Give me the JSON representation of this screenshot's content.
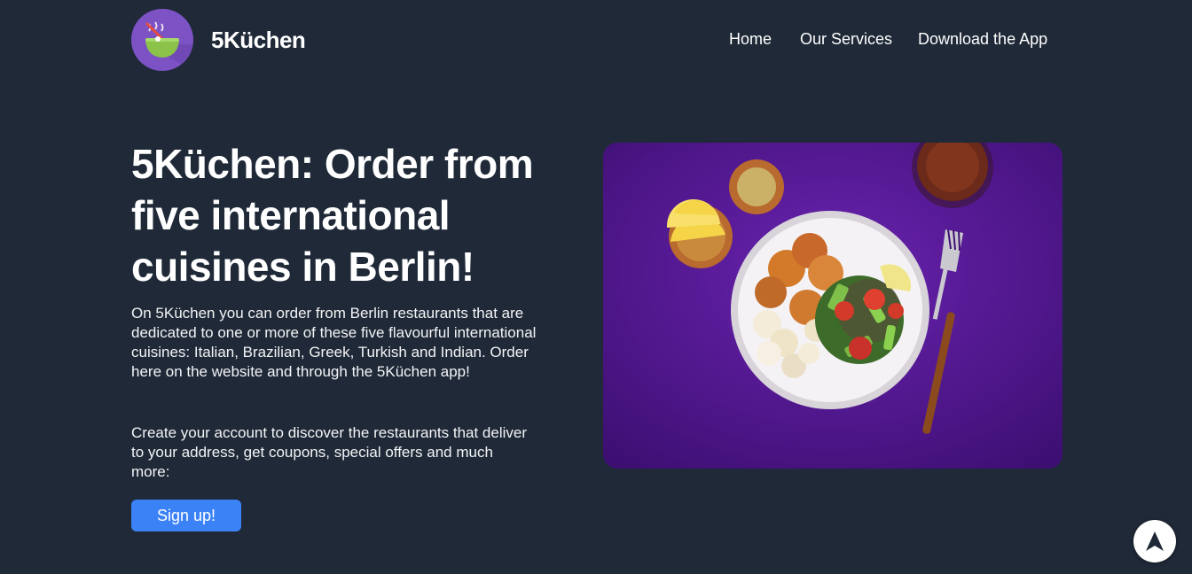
{
  "header": {
    "brand": "5Küchen",
    "logo_icon": "bowl-icon",
    "nav": [
      {
        "label": "Home"
      },
      {
        "label": "Our Services"
      },
      {
        "label": "Download the App"
      }
    ]
  },
  "hero": {
    "title": "5Küchen: Order from five international cuisines in Berlin!",
    "paragraph_1": "On 5Küchen you can order from Berlin restaurants that are dedicated to one or more of these five flavourful international cuisines: Italian, Brazilian, Greek, Turkish and Indian. Order here on the website and through the 5Küchen app!",
    "paragraph_2": "Create your account to discover the restaurants that deliver to your address, get coupons, special offers and much more:",
    "signup_label": "Sign up!",
    "image_icon": "food-plate-image"
  },
  "scroll_top": {
    "icon": "arrow-up-icon"
  },
  "colors": {
    "background": "#1f2937",
    "accent": "#3b82f6",
    "logo_purple": "#7c52c4",
    "image_purple": "#5b1a9c"
  }
}
